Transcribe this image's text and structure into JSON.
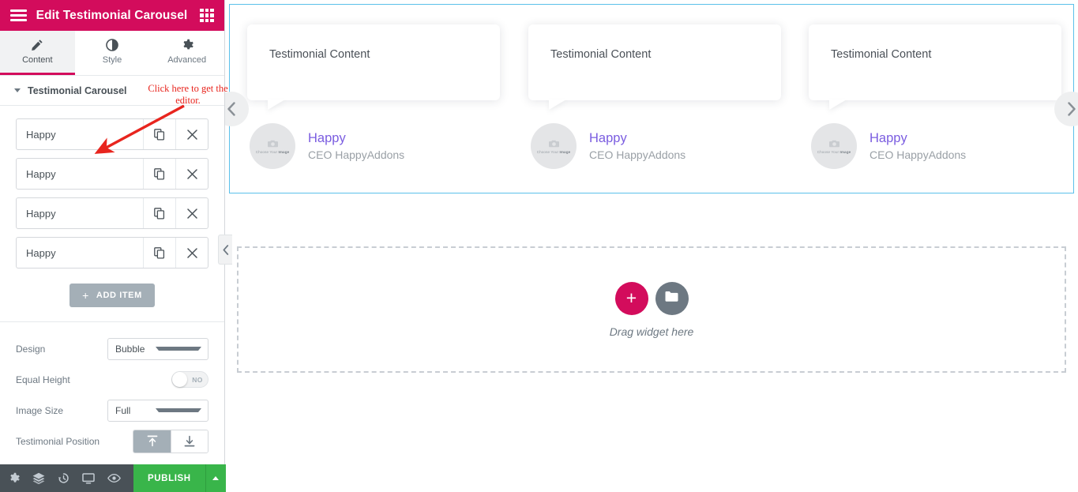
{
  "panel": {
    "header": {
      "title": "Edit Testimonial Carousel",
      "menu_icon": "hamburger-icon",
      "widgets_icon": "grid-icon"
    },
    "tabs": [
      {
        "label": "Content",
        "icon": "pencil-icon",
        "active": true
      },
      {
        "label": "Style",
        "icon": "contrast-icon",
        "active": false
      },
      {
        "label": "Advanced",
        "icon": "gear-icon",
        "active": false
      }
    ],
    "section_title": "Testimonial Carousel",
    "repeater_items": [
      {
        "label": "Happy"
      },
      {
        "label": "Happy"
      },
      {
        "label": "Happy"
      },
      {
        "label": "Happy"
      }
    ],
    "add_item_label": "ADD ITEM",
    "add_item_plus": "+",
    "controls": [
      {
        "label": "Design",
        "type": "select",
        "value": "Bubble"
      },
      {
        "label": "Equal Height",
        "type": "switch",
        "value": "NO"
      },
      {
        "label": "Image Size",
        "type": "select",
        "value": "Full"
      },
      {
        "label": "Testimonial Position",
        "type": "buttons",
        "options": [
          "align-top-icon",
          "align-bottom-icon"
        ],
        "active_index": 0
      }
    ],
    "footer": {
      "icons": [
        "gear-icon",
        "layers-icon",
        "history-icon",
        "responsive-icon",
        "preview-eye-icon"
      ],
      "publish_label": "PUBLISH",
      "publish_more_icon": "chevron-up-icon"
    }
  },
  "canvas": {
    "slides": [
      {
        "content": "Testimonial Content",
        "name": "Happy",
        "title": "CEO HappyAddons",
        "avatar_placeholder": "Choose Your ",
        "avatar_placeholder_bold": "Image"
      },
      {
        "content": "Testimonial Content",
        "name": "Happy",
        "title": "CEO HappyAddons",
        "avatar_placeholder": "Choose Your ",
        "avatar_placeholder_bold": "Image"
      },
      {
        "content": "Testimonial Content",
        "name": "Happy",
        "title": "CEO HappyAddons",
        "avatar_placeholder": "Choose Your ",
        "avatar_placeholder_bold": "Image"
      }
    ],
    "prev_icon": "chevron-left-icon",
    "next_icon": "chevron-right-icon",
    "dropzone": {
      "add_icon": "plus-icon",
      "folder_icon": "folder-icon",
      "text": "Drag widget here"
    },
    "panel_collapse_icon": "chevron-left-icon"
  },
  "annotation": {
    "line1": "Click here to get the",
    "line2": "editor."
  },
  "colors": {
    "brand_pink": "#d30c5c",
    "publish_green": "#39b54a",
    "section_border": "#5bc0ea",
    "name_purple": "#7a5ce0",
    "annotation_red": "#e8251e"
  }
}
